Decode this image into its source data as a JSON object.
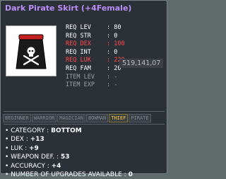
{
  "item": {
    "name": "Dark Pirate Skirt (+4Female)",
    "icon": "skull-crossbones-skirt-icon"
  },
  "requirements": [
    {
      "label": "REQ LEV",
      "value": ": 80",
      "status": "ok"
    },
    {
      "label": "REQ STR",
      "value": ": 0",
      "status": "ok"
    },
    {
      "label": "REQ DEX",
      "value": ": 100",
      "status": "unmet"
    },
    {
      "label": "REQ INT",
      "value": ": 0",
      "status": "ok"
    },
    {
      "label": "REQ LUK",
      "value": ": 220",
      "status": "unmet"
    },
    {
      "label": "REQ FAM",
      "value": ": 20",
      "status": "ok"
    },
    {
      "label": "ITEM LEV",
      "value": ": -",
      "status": "dim"
    },
    {
      "label": "ITEM EXP",
      "value": ": -",
      "status": "dim"
    }
  ],
  "overlay_number": "519,141,07",
  "jobs": [
    "BEGINNER",
    "WARRIOR",
    "MAGICIAN",
    "BOWMAN",
    "THIEF",
    "PIRATE"
  ],
  "active_job": "THIEF",
  "stats": [
    {
      "label": "• CATEGORY :",
      "value": "BOTTOM"
    },
    {
      "label": "• DEX :",
      "value": "+13"
    },
    {
      "label": "• LUK :",
      "value": "+9"
    },
    {
      "label": "• WEAPON DEF. :",
      "value": "53"
    },
    {
      "label": "• ACCURACY :",
      "value": "+4"
    },
    {
      "label": "• NUMBER OF UPGRADES AVAILABLE :",
      "value": "0"
    }
  ],
  "colors": {
    "title": "#b98ef8",
    "unmet": "#ff4a4a",
    "active_job": "#ffcc33",
    "panel": "#2c3138"
  }
}
